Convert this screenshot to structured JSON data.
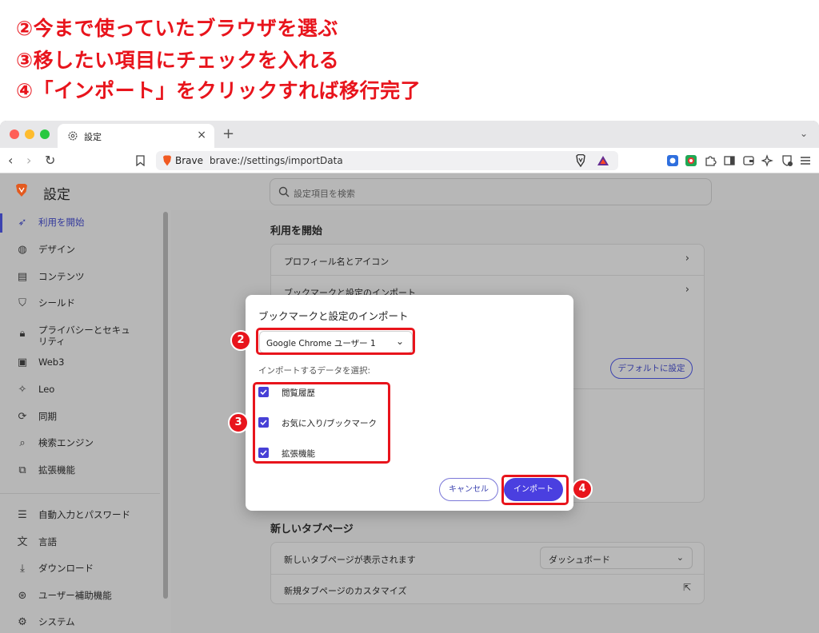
{
  "instructions": [
    "②今まで使っていたブラウザを選ぶ",
    "③移したい項目にチェックを入れる",
    "④「インポート」をクリックすれば移行完了"
  ],
  "browser": {
    "tab_title": "設定",
    "url_brand": "Brave",
    "url": "brave://settings/importData",
    "new_tab": "+",
    "tab_close": "×"
  },
  "sidebar": {
    "title": "設定",
    "items": [
      {
        "label": "利用を開始",
        "icon": "rocket-icon"
      },
      {
        "label": "デザイン",
        "icon": "palette-icon"
      },
      {
        "label": "コンテンツ",
        "icon": "content-icon"
      },
      {
        "label": "シールド",
        "icon": "shield-icon"
      },
      {
        "label": "プライバシーとセキュ\nリティ",
        "icon": "lock-icon"
      },
      {
        "label": "Web3",
        "icon": "wallet-icon"
      },
      {
        "label": "Leo",
        "icon": "sparkle-icon"
      },
      {
        "label": "同期",
        "icon": "sync-icon"
      },
      {
        "label": "検索エンジン",
        "icon": "search-icon"
      },
      {
        "label": "拡張機能",
        "icon": "puzzle-icon"
      },
      {
        "label": "自動入力とパスワード",
        "icon": "list-icon"
      },
      {
        "label": "言語",
        "icon": "translate-icon"
      },
      {
        "label": "ダウンロード",
        "icon": "download-icon"
      },
      {
        "label": "ユーザー補助機能",
        "icon": "accessibility-icon"
      },
      {
        "label": "システム",
        "icon": "gear-icon"
      }
    ]
  },
  "search": {
    "placeholder": "設定項目を検索"
  },
  "main": {
    "section1_title": "利用を開始",
    "rows": [
      "プロフィール名とアイコン",
      "ブックマークと設定のインポート"
    ],
    "default_button": "デフォルトに設定",
    "section2_title": "新しいタブページ",
    "ntp_row_label": "新しいタブページが表示されます",
    "ntp_select_value": "ダッシュボード",
    "ntp_customize": "新規タブページのカスタマイズ"
  },
  "dialog": {
    "title": "ブックマークと設定のインポート",
    "profile_value": "Google Chrome ユーザー 1",
    "subtitle": "インポートするデータを選択:",
    "checkboxes": [
      {
        "label": "閲覧履歴",
        "checked": true
      },
      {
        "label": "お気に入り/ブックマーク",
        "checked": true
      },
      {
        "label": "拡張機能",
        "checked": true
      }
    ],
    "cancel": "キャンセル",
    "import": "インポート"
  },
  "badges": [
    "2",
    "3",
    "4"
  ],
  "colors": {
    "annotation": "#e8141c",
    "accent": "#4a3fe0"
  }
}
